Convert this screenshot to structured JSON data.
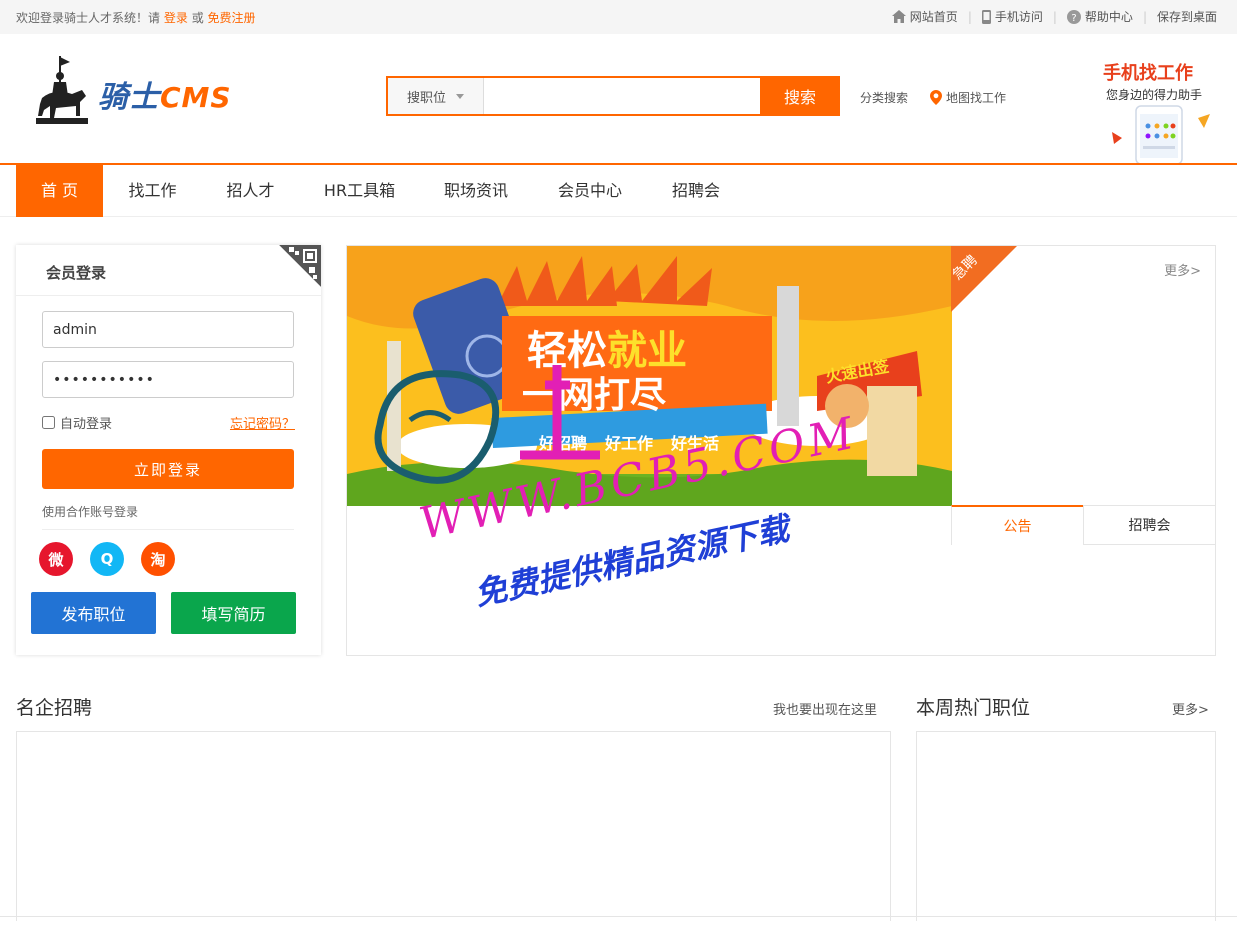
{
  "topbar": {
    "welcome_prefix": "欢迎登录骑士人才系统！请",
    "login_link": "登录",
    "or_text": "或",
    "register_link": "免费注册",
    "links": [
      {
        "icon": "home-icon",
        "label": "网站首页"
      },
      {
        "icon": "mobile-icon",
        "label": "手机访问"
      },
      {
        "icon": "help-icon",
        "label": "帮助中心"
      },
      {
        "icon": "",
        "label": "保存到桌面"
      }
    ],
    "separator": "|"
  },
  "header": {
    "logo_main": "骑士",
    "logo_sub": "CMS",
    "search": {
      "type_label": "搜职位",
      "input_value": "",
      "button_label": "搜索"
    },
    "category_search": "分类搜索",
    "map_search": "地图找工作",
    "mobile_title": "手机找工作",
    "mobile_sub": "您身边的得力助手"
  },
  "nav": {
    "items": [
      "首 页",
      "找工作",
      "招人才",
      "HR工具箱",
      "职场资讯",
      "会员中心",
      "招聘会"
    ],
    "active_index": 0
  },
  "login": {
    "title": "会员登录",
    "username": "admin",
    "password": "•••••••••••",
    "remember": "自动登录",
    "forgot": "忘记密码？",
    "submit": "立即登录",
    "partner": "使用合作账号登录",
    "social": [
      {
        "icon": "weibo-icon",
        "glyph": "微",
        "color": "#e6162d"
      },
      {
        "icon": "qq-icon",
        "glyph": "Q",
        "color": "#12b7f5"
      },
      {
        "icon": "taobao-icon",
        "glyph": "淘",
        "color": "#ff5000"
      }
    ],
    "post_job": "发布职位",
    "fill_resume": "填写简历"
  },
  "feature": {
    "banner_headline_1": "轻松",
    "banner_headline_2": "就业",
    "banner_line2": "一网打尽",
    "banner_tags": [
      "好招聘",
      "好工作",
      "好生活"
    ],
    "flag_text": "火速出签",
    "urgent": "急聘",
    "more": "更多>",
    "tabs": [
      "公告",
      "招聘会"
    ],
    "active_tab": 0
  },
  "watermark": {
    "line1": "WWW.BCB5.COM",
    "line2": "免费提供精品资源下载"
  },
  "sections": {
    "famous": {
      "title": "名企招聘",
      "action": "我也要出现在这里"
    },
    "hot": {
      "title": "本周热门职位",
      "more": "更多>"
    }
  },
  "colors": {
    "accent": "#ff6600",
    "blue": "#2273d4",
    "green": "#0aa64c"
  }
}
